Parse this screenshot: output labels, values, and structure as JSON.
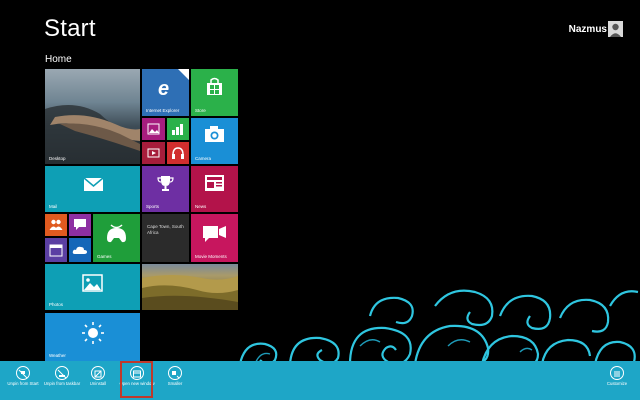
{
  "screen": {
    "title": "Start",
    "group_label": "Home",
    "user_name": "Nazmus"
  },
  "tiles": {
    "desktop": "Desktop",
    "internet_explorer": "Internet Explorer",
    "store": "Store",
    "camera": "Camera",
    "mail": "Mail",
    "sports": "Sports",
    "news": "News",
    "games": "Games",
    "weather_city": "Cape Town, South Africa",
    "movie_moments": "Movie Moments",
    "photos": "Photos",
    "weather": "Weather"
  },
  "app_bar": {
    "unpin_start": "Unpin from Start",
    "unpin_taskbar": "Unpin from taskbar",
    "uninstall": "Uninstall",
    "open_new_window": "Open new window",
    "smaller": "Smaller",
    "customize": "Customize"
  },
  "colors": {
    "app_bar": "#1ea6c7",
    "selection_outline": "#c0392b",
    "background": "#000000"
  },
  "icons": [
    "user-icon",
    "internet-explorer-icon",
    "store-icon",
    "camera-icon",
    "mail-icon",
    "sports-trophy-icon",
    "news-icon",
    "games-controller-icon",
    "movie-moments-icon",
    "photos-icon",
    "weather-sun-icon",
    "unpin-icon",
    "uninstall-icon",
    "open-window-icon",
    "smaller-icon",
    "customize-icon"
  ]
}
